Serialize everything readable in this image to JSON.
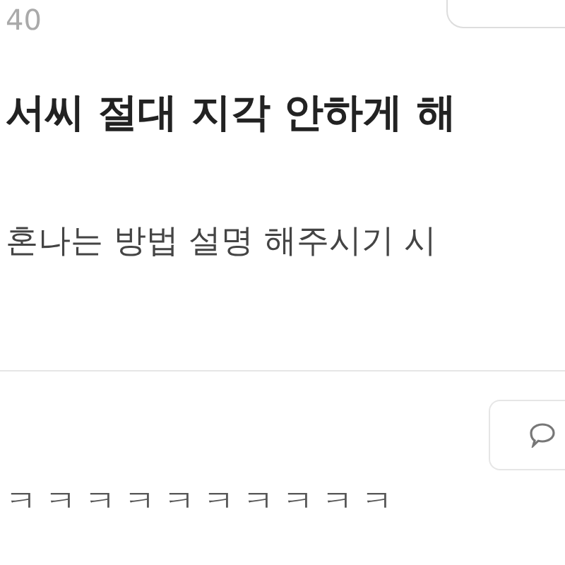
{
  "post_meta": {
    "count": "40"
  },
  "post": {
    "title": "서씨 절대 지각 안하게 해",
    "body": "혼나는 방법 설명 해주시기 시"
  },
  "comment": {
    "text": "ㅋㅋㅋㅋㅋㅋㅋㅋㅋㅋ"
  }
}
